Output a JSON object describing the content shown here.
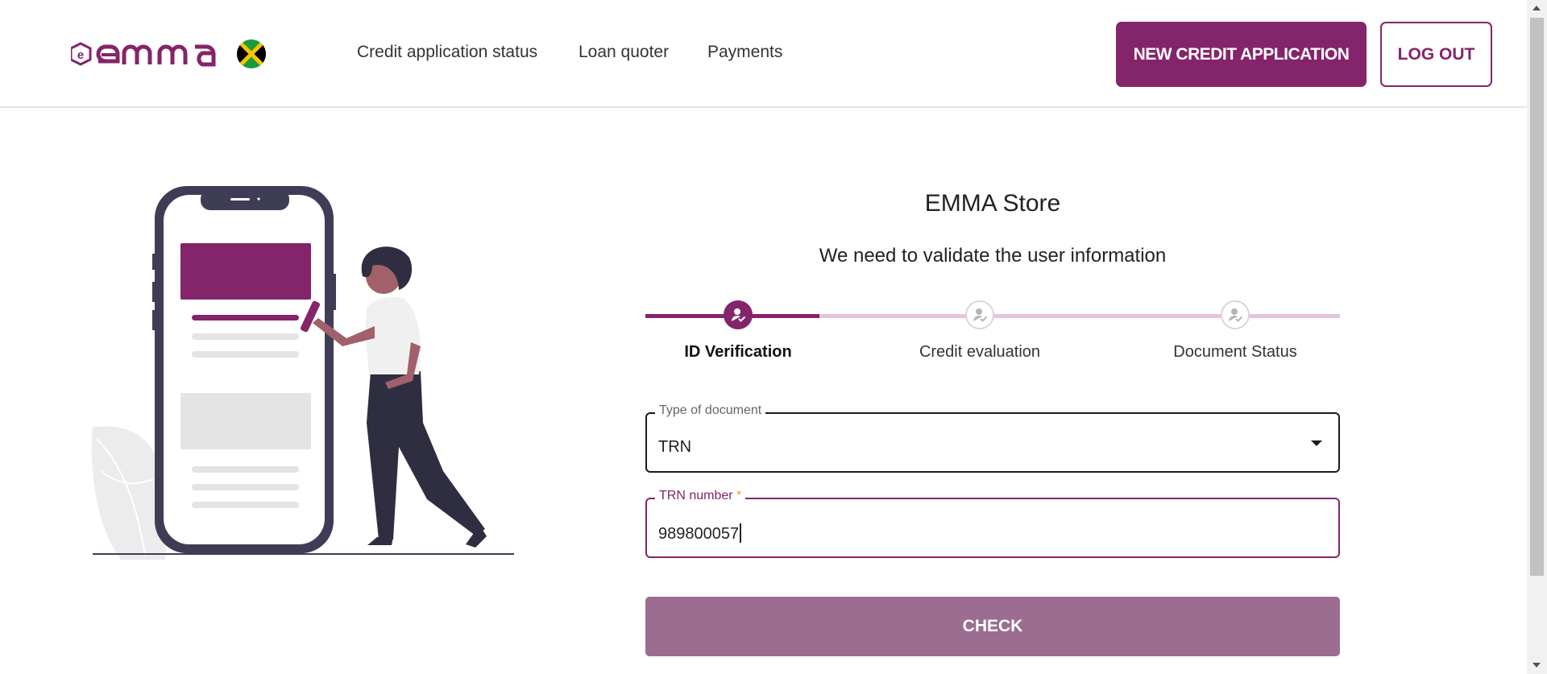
{
  "header": {
    "logo_text": "emma",
    "nav": [
      {
        "label": "Credit application status"
      },
      {
        "label": "Loan quoter"
      },
      {
        "label": "Payments"
      }
    ],
    "new_application_label": "NEW CREDIT APPLICATION",
    "logout_label": "LOG OUT"
  },
  "form": {
    "store_title": "EMMA Store",
    "subtitle": "We need to validate the user information",
    "steps": [
      {
        "label": "ID Verification",
        "active": true
      },
      {
        "label": "Credit evaluation",
        "active": false
      },
      {
        "label": "Document Status",
        "active": false
      }
    ],
    "document_type": {
      "label": "Type of document",
      "value": "TRN"
    },
    "trn": {
      "label": "TRN number",
      "required_mark": "*",
      "value": "989800057"
    },
    "check_label": "CHECK"
  },
  "colors": {
    "brand": "#84246a",
    "brand_light": "#e3c5da",
    "button_disabled": "#9b6d90",
    "flag_green": "#1a9c3b",
    "flag_gold": "#f7c600",
    "flag_black": "#000000"
  },
  "icons": [
    "jamaica-flag-icon",
    "user-check-icon",
    "chevron-down-icon"
  ]
}
